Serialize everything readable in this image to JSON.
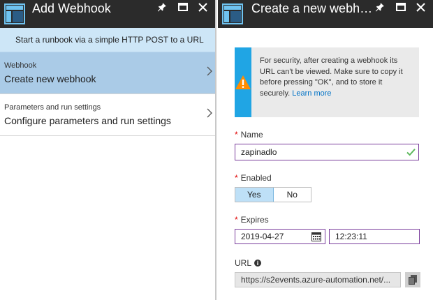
{
  "left_blade": {
    "title": "Add Webhook",
    "banner": "Start a runbook via a simple HTTP POST to a URL",
    "items": [
      {
        "sub": "Webhook",
        "label": "Create new webhook",
        "selected": true
      },
      {
        "sub": "Parameters and run settings",
        "label": "Configure parameters and run settings",
        "selected": false
      }
    ],
    "icons": [
      "blade-icon",
      "pin-icon",
      "maximize-icon",
      "close-icon",
      "chevron-right-icon"
    ]
  },
  "right_blade": {
    "title": "Create a new webhook",
    "warning": {
      "text": "For security, after creating a webhook its URL can't be viewed. Make sure to copy it before pressing \"OK\", and to store it securely.",
      "link": "Learn more",
      "icon": "warning-icon"
    },
    "name": {
      "label": "Name",
      "value": "zapinadlo",
      "valid_icon": "checkmark-icon"
    },
    "enabled": {
      "label": "Enabled",
      "yes": "Yes",
      "no": "No",
      "selected": "Yes"
    },
    "expires": {
      "label": "Expires",
      "date": "2019-04-27",
      "time": "12:23:11",
      "date_icon": "calendar-icon"
    },
    "url": {
      "label": "URL",
      "value": "https://s2events.azure-automation.net/...",
      "info_icon": "info-icon",
      "copy_icon": "copy-icon"
    }
  },
  "colors": {
    "titlebar": "#2b2b2b",
    "banner": "#cde6f7",
    "selected_item": "#aacbe7",
    "warning_accent": "#20a5e4",
    "input_border": "#7a3d9c",
    "toggle_on": "#bee0f7",
    "link": "#0072c6",
    "required": "#e00000",
    "valid": "#5cb85c"
  }
}
